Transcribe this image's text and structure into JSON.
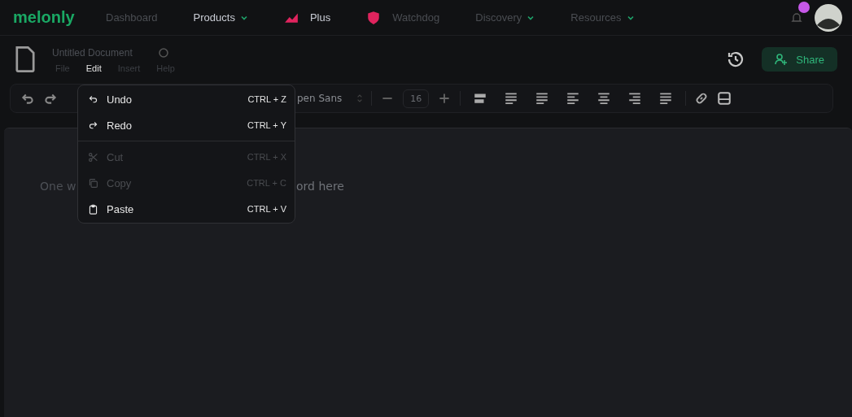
{
  "nav": {
    "logo": "melonly",
    "items": [
      {
        "label": "Dashboard",
        "kind": "link"
      },
      {
        "label": "Products",
        "kind": "dropdown"
      },
      {
        "label": "Plus",
        "kind": "icon-link"
      },
      {
        "label": "Watchdog",
        "kind": "icon-link"
      },
      {
        "label": "Discovery",
        "kind": "dropdown"
      },
      {
        "label": "Resources",
        "kind": "dropdown"
      }
    ],
    "notifications": {
      "unread": true
    }
  },
  "document": {
    "title": "Untitled Document",
    "menus": [
      {
        "label": "File",
        "selected": false
      },
      {
        "label": "Edit",
        "selected": true
      },
      {
        "label": "Insert",
        "selected": false
      },
      {
        "label": "Help",
        "selected": false
      }
    ],
    "share": "Share"
  },
  "toolbar": {
    "font": "pen Sans",
    "font_size": "16"
  },
  "editor": {
    "placeholder_parts": [
      "One w",
      "ord here"
    ]
  },
  "edit_menu": {
    "items": [
      {
        "label": "Undo",
        "shortcut": "CTRL + Z",
        "disabled": false,
        "separator_after": false
      },
      {
        "label": "Redo",
        "shortcut": "CTRL + Y",
        "disabled": false,
        "separator_after": true
      },
      {
        "label": "Cut",
        "shortcut": "CTRL + X",
        "disabled": true,
        "separator_after": false
      },
      {
        "label": "Copy",
        "shortcut": "CTRL + C",
        "disabled": true,
        "separator_after": false
      },
      {
        "label": "Paste",
        "shortcut": "CTRL + V",
        "disabled": false,
        "separator_after": false
      }
    ]
  }
}
